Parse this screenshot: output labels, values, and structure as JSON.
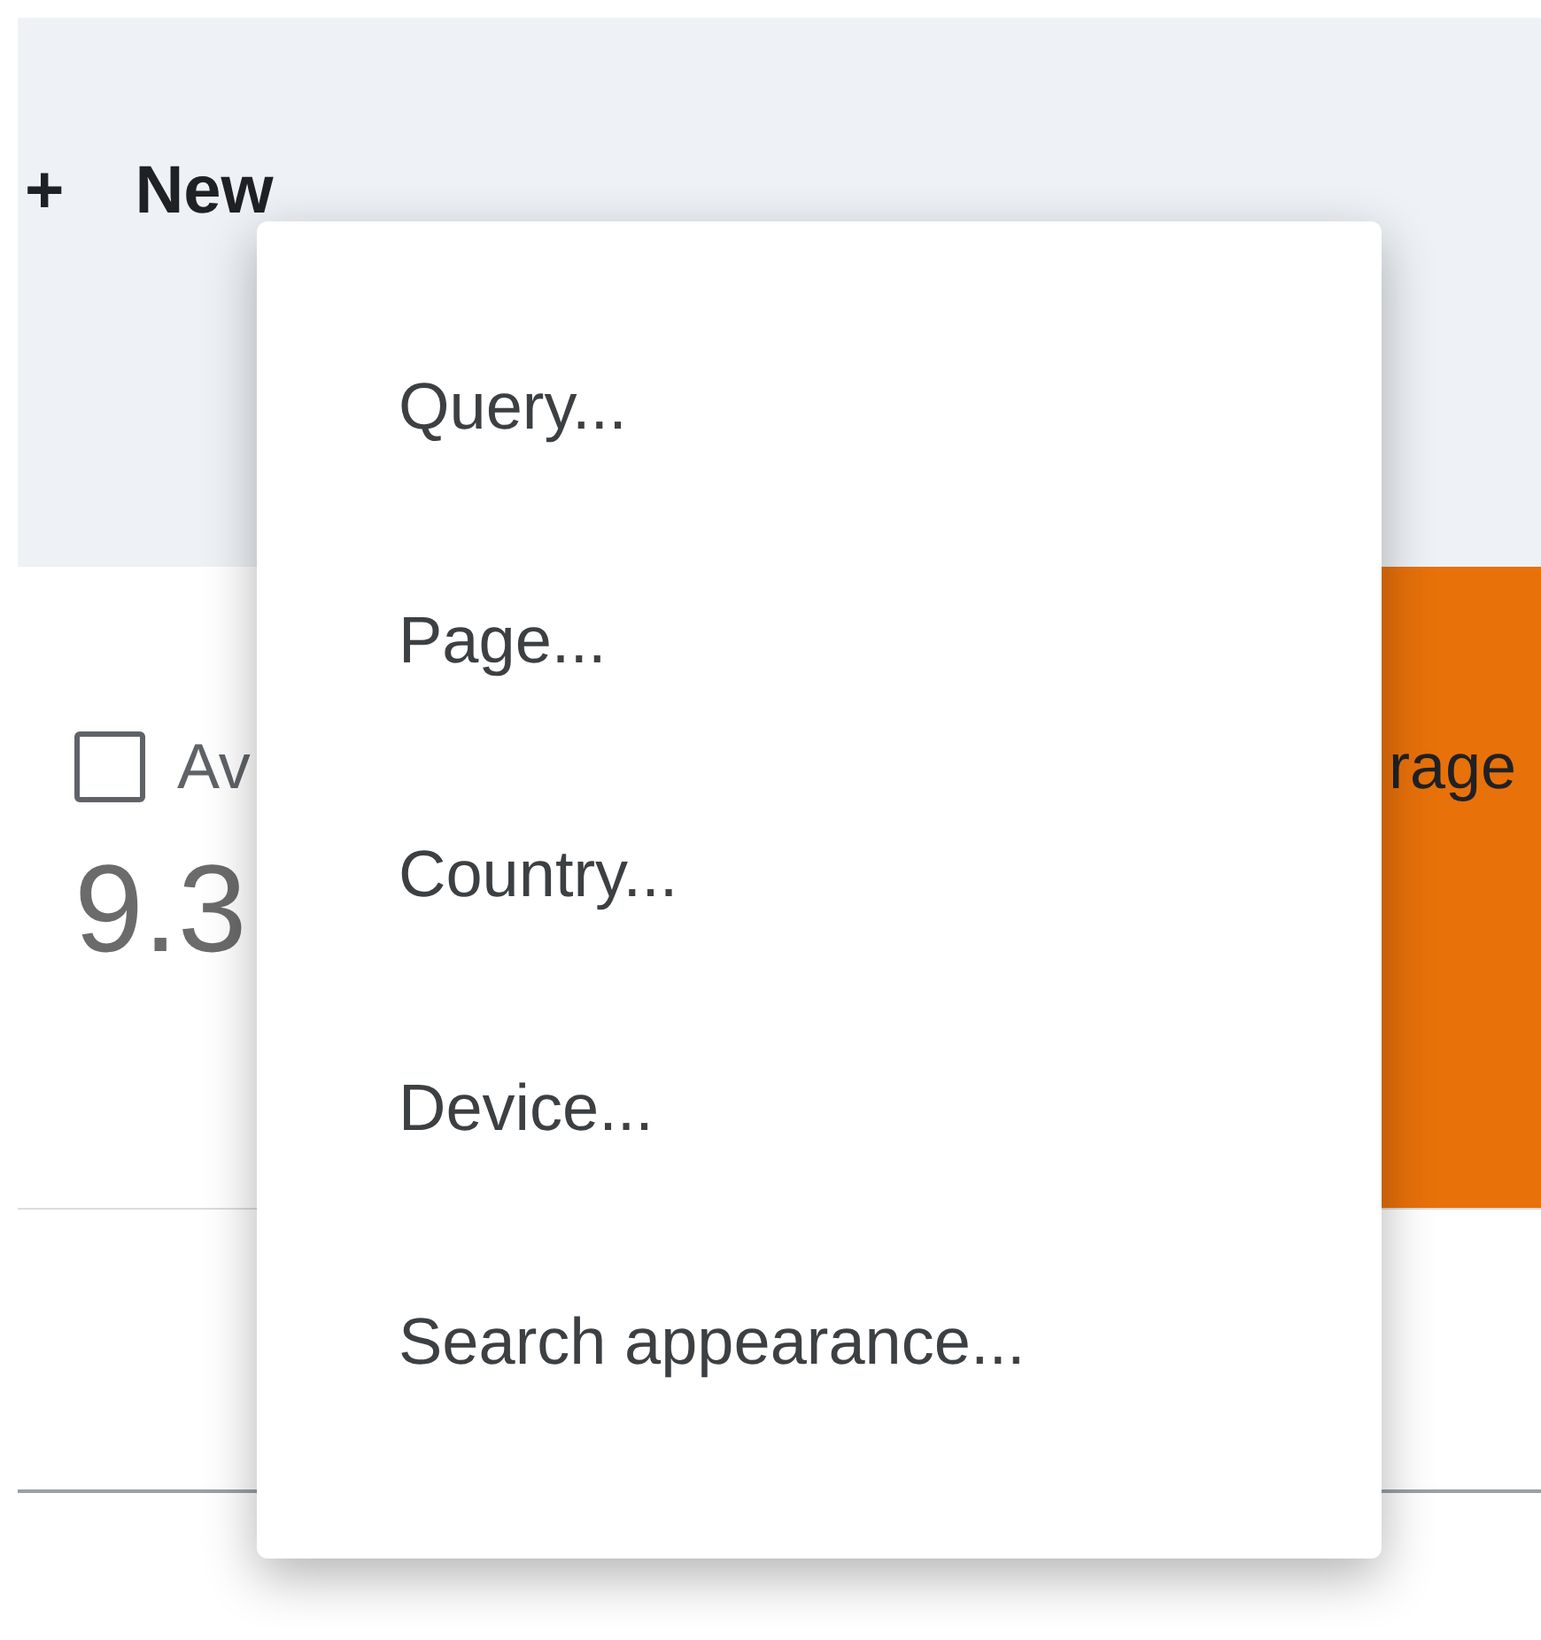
{
  "toolbar": {
    "new_button": {
      "icon": "+",
      "label": "New"
    }
  },
  "metrics": [
    {
      "kind": "plain",
      "label": "Av",
      "value": "9.3",
      "checked": false
    },
    {
      "kind": "highlighted",
      "label": "rage"
    }
  ],
  "menu": {
    "items": [
      {
        "label": "Query..."
      },
      {
        "label": "Page..."
      },
      {
        "label": "Country..."
      },
      {
        "label": "Device..."
      },
      {
        "label": "Search appearance..."
      }
    ]
  }
}
